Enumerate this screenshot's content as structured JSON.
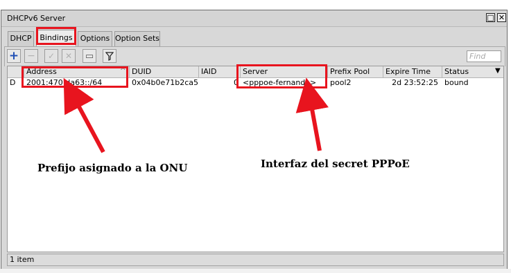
{
  "window": {
    "title": "DHCPv6 Server",
    "restore_symbol": "□",
    "close_symbol": "✕"
  },
  "tabs": [
    {
      "label": "DHCP"
    },
    {
      "label": "Bindings"
    },
    {
      "label": "Options"
    },
    {
      "label": "Option Sets"
    }
  ],
  "toolbar": {
    "add_symbol": "+",
    "remove_symbol": "−",
    "enable_symbol": "✓",
    "disable_symbol": "✕",
    "comment_symbol": "▭",
    "filter_symbol": "⏷",
    "find_placeholder": "Find"
  },
  "table": {
    "columns": [
      "",
      "Address",
      "DUID",
      "IAID",
      "Server",
      "Prefix Pool",
      "Expire Time",
      "Status"
    ],
    "rows": [
      {
        "flag": "D",
        "address": "2001:470:da63::/64",
        "duid": "0x04b0e71b2ca5",
        "iaid": "0",
        "server": "<pppoe-fernando>",
        "prefix_pool": "pool2",
        "expire_time": "2d 23:52:25",
        "status": "bound"
      }
    ],
    "sort_indicator": "^",
    "column_menu_symbol": "▼"
  },
  "status_bar": {
    "item_count": "1 item"
  },
  "annotations": {
    "prefix_note": "Prefijo asignado a la ONU",
    "secret_note": "Interfaz del secret PPPoE"
  },
  "colors": {
    "highlight_red": "#e8141e",
    "add_blue": "#1f4fb5"
  }
}
